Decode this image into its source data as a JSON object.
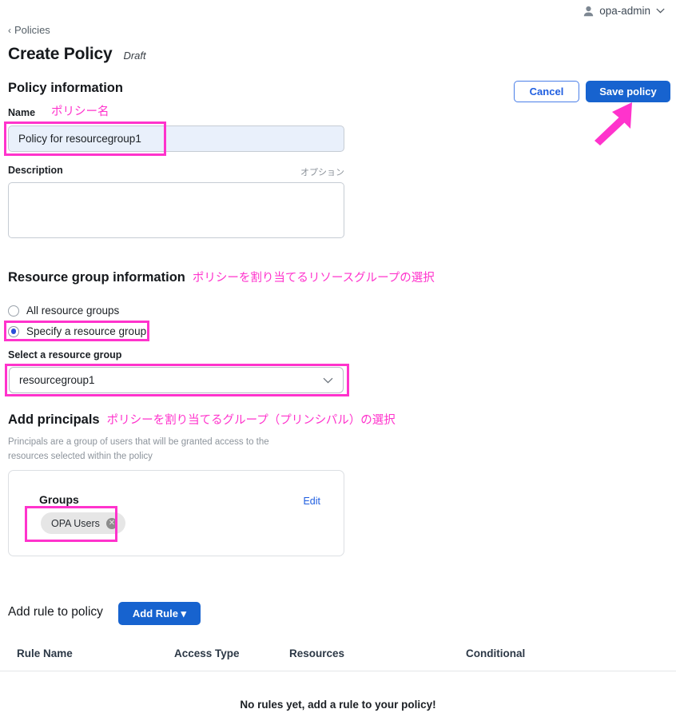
{
  "topbar": {
    "user_name": "opa-admin",
    "person_icon": "person-icon",
    "chevron_icon": "chevron-down-icon"
  },
  "breadcrumb": {
    "caret": "‹",
    "label": "Policies"
  },
  "header": {
    "title": "Create Policy",
    "status": "Draft"
  },
  "actions": {
    "cancel_label": "Cancel",
    "save_label": "Save policy"
  },
  "policy_information": {
    "section_title": "Policy information",
    "annotation": "ポリシー名",
    "name_label": "Name",
    "name_value": "Policy for resourcegroup1",
    "description_label": "Description",
    "description_optional": "オプション",
    "description_value": ""
  },
  "resource_group": {
    "section_title": "Resource group information",
    "annotation": "ポリシーを割り当てるリソースグループの選択",
    "radio_all_label": "All resource groups",
    "radio_specify_label": "Specify a resource group",
    "selected_radio": "specify",
    "select_label": "Select a resource group",
    "select_value": "resourcegroup1",
    "select_caret_icon": "chevron-down-icon"
  },
  "principals": {
    "section_title": "Add principals",
    "annotation": "ポリシーを割り当てるグループ（プリンシパル）の選択",
    "helper_text": "Principals are a group of users that will be granted access to the resources selected within the policy",
    "groups_title": "Groups",
    "edit_label": "Edit",
    "chips": [
      {
        "label": "OPA Users",
        "remove_icon": "✕"
      }
    ]
  },
  "rules": {
    "add_rule_label": "Add rule to policy",
    "add_rule_button": "Add Rule ▾",
    "columns": [
      "Rule Name",
      "Access Type",
      "Resources",
      "Conditional"
    ],
    "rows": [],
    "empty_message": "No rules yet, add a rule to your policy!"
  },
  "annotation_color": "#ff33cc",
  "accent_color": "#1763cf"
}
